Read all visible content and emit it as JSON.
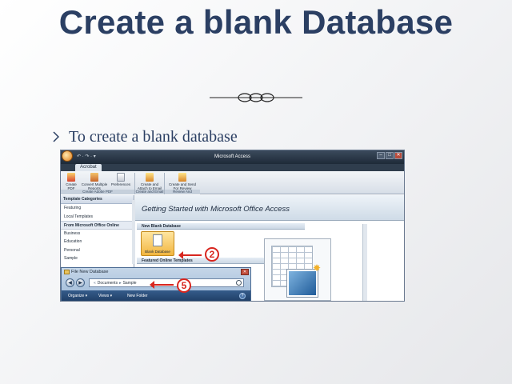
{
  "slide": {
    "title": "Create a blank Database",
    "bullet": "To create a blank database"
  },
  "access": {
    "window_title": "Microsoft Access",
    "tab_active": "Acrobat",
    "qat": "↶ · ↷ · ▾",
    "window_controls": [
      "–",
      "□",
      "✕"
    ],
    "ribbon": {
      "buttons": [
        {
          "label": "Create PDF",
          "icon": "pdf-icon"
        },
        {
          "label": "Convert Multiple Reports",
          "icon": "convert-icon"
        },
        {
          "label": "Preferences",
          "icon": "preferences-icon"
        },
        {
          "label": "Create and Attach to Email",
          "icon": "attach-email-icon"
        },
        {
          "label": "Create and Send For Review",
          "icon": "send-review-icon"
        }
      ],
      "groups": [
        "Create Adobe PDF",
        "Create and Email",
        "Review And Comment"
      ]
    },
    "left_pane": {
      "header": "Template Categories",
      "items": [
        "Featuring",
        "Local Templates"
      ],
      "section": "From Microsoft Office Online",
      "online_items": [
        "Business",
        "Education",
        "Personal",
        "Sample"
      ]
    },
    "main": {
      "banner": "Getting Started with Microsoft Office Access",
      "new_blank_header": "New Blank Database",
      "blank_db_label": "Blank Database",
      "featured_header": "Featured Online Templates"
    },
    "dialog": {
      "title": "File New Database",
      "close": "✕",
      "back": "◀",
      "forward": "▶",
      "path": [
        "Documents",
        "Sample"
      ],
      "toolbar": {
        "organize": "Organize ▾",
        "views": "Views ▾",
        "new_folder": "New Folder"
      },
      "help": "?"
    }
  },
  "callouts": [
    "2",
    "5"
  ],
  "colors": {
    "title": "#2b3f63",
    "callout": "#d8261f"
  }
}
